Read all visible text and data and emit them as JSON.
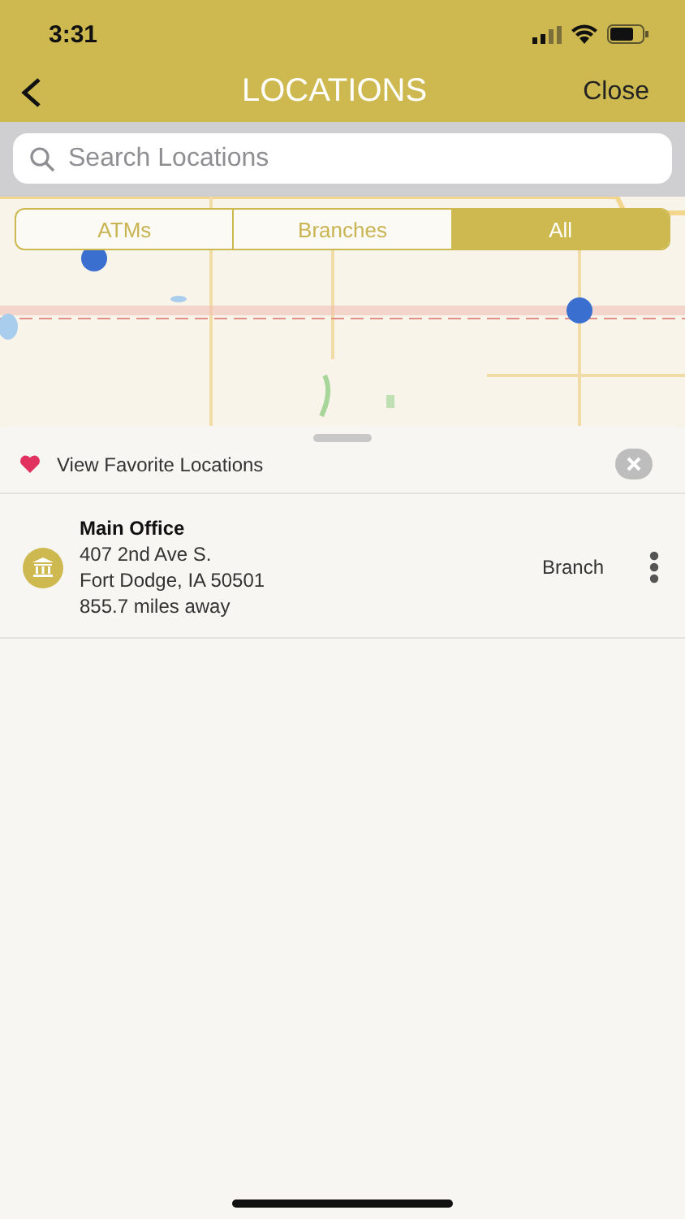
{
  "status_bar": {
    "time": "3:31"
  },
  "nav": {
    "title": "LOCATIONS",
    "close": "Close"
  },
  "search": {
    "placeholder": "Search Locations"
  },
  "filters": [
    {
      "label": "ATMs",
      "selected": false
    },
    {
      "label": "Branches",
      "selected": false
    },
    {
      "label": "All",
      "selected": true
    }
  ],
  "favorites": {
    "label": "View Favorite Locations"
  },
  "locations": [
    {
      "name": "Main Office",
      "address": "407 2nd Ave S.",
      "city": "Fort Dodge, IA 50501",
      "distance": "855.7 miles away",
      "type": "Branch"
    }
  ]
}
